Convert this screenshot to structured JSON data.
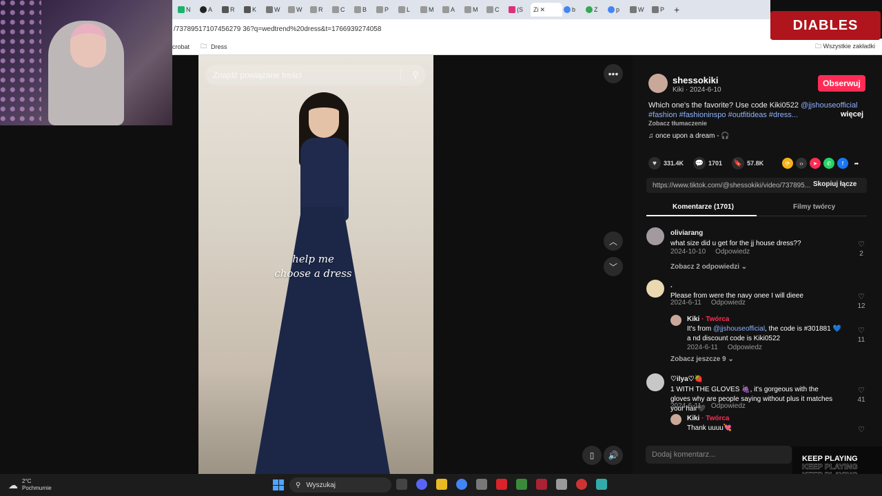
{
  "browser": {
    "tabs": [
      "N",
      "A",
      "R",
      "K",
      "W",
      "W",
      "R",
      "C",
      "B",
      "P",
      "L",
      "M",
      "A",
      "M",
      "C",
      "(S",
      "Zi",
      "b",
      "Z",
      "p",
      "W",
      "P"
    ],
    "active_tab": "Zi",
    "url": "/73789517107456279 36?q=wedtrend%20dress&t=1766939274058",
    "bookmarks": [
      "crobat",
      "Dress"
    ],
    "all_bookmarks": "Wszystkie zakładki"
  },
  "overlay": {
    "brand": "DIABLES"
  },
  "video": {
    "search_placeholder": "Znajdź powiązane treści",
    "caption_line1": "help me",
    "caption_line2": "choose a dress"
  },
  "post": {
    "author": "shessokiki",
    "author_sub": "Kiki · 2024-6-10",
    "follow_label": "Obserwuj",
    "description_text": "Which one's the favorite? Use code Kiki0522 ",
    "mention": "@jjshouseofficial",
    "hashtags": "#fashion #fashioninspo #outfitideas #dress...",
    "more_label": "więcej",
    "translate_label": "Zobacz tłumaczenie",
    "music": "♫  once upon a dream - 🎧",
    "likes": "331.4K",
    "comments_count": "1701",
    "saves": "57.8K",
    "link": "https://www.tiktok.com/@shessokiki/video/737895...",
    "copy_label": "Skopiuj łącze",
    "tab_comments": "Komentarze (1701)",
    "tab_creator_videos": "Filmy twórcy"
  },
  "comments": [
    {
      "user": "oliviarang",
      "text": "what size did u get for the jj house dress??",
      "date": "2024-10-10",
      "reply": "Odpowiedz",
      "likes": "2",
      "more": "Zobacz 2 odpowiedzi ⌄"
    },
    {
      "user": ".",
      "text": "Please from were the navy onee I will dieee",
      "date": "2024-6-11",
      "reply": "Odpowiedz",
      "likes": "12",
      "more": "Zobacz jeszcze 9 ⌄"
    },
    {
      "user": "Kiki",
      "creator": " · Twórca",
      "text_before": "It's from ",
      "mention": "@jjshouseofficial",
      "text_after": ", the code is #301881 💙 a nd discount code is Kiki0522",
      "date": "2024-6-11",
      "reply": "Odpowiedz",
      "likes": "11"
    },
    {
      "user": "♡ilya♡🍓",
      "text": "1 WITH THE GLOVES 🍇, it's gorgeous with the gloves why are people saying without plus it matches your hair🖤",
      "date": "2024-6-11",
      "reply": "Odpowiedz",
      "likes": "41"
    },
    {
      "user": "Kiki",
      "creator": " · Twórca",
      "text": "Thank uuuu💘"
    }
  ],
  "composer_placeholder": "Dodaj komentarz...",
  "keep_playing": "KEEP PLAYING",
  "taskbar": {
    "temp": "2°C",
    "weather": "Pochmurnie",
    "search": "Wyszukaj"
  }
}
